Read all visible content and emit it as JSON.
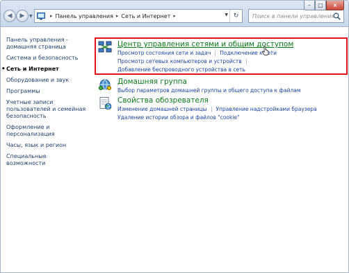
{
  "window": {
    "caption": {
      "minimize": "–",
      "maximize": "□",
      "close": "×"
    }
  },
  "toolbar": {
    "breadcrumb": [
      "Панель управления",
      "Сеть и Интернет"
    ],
    "search_placeholder": "Поиск в панели управления"
  },
  "sidebar": {
    "items": [
      {
        "label": "Панель управления - домашняя страница",
        "active": false
      },
      {
        "label": "Система и безопасность",
        "active": false
      },
      {
        "label": "Сеть и Интернет",
        "active": true
      },
      {
        "label": "Оборудование и звук",
        "active": false
      },
      {
        "label": "Программы",
        "active": false
      },
      {
        "label": "Учетные записи пользователей и семейная безопасность",
        "active": false
      },
      {
        "label": "Оформление и персонализация",
        "active": false
      },
      {
        "label": "Часы, язык и регион",
        "active": false
      },
      {
        "label": "Специальные возможности",
        "active": false
      }
    ]
  },
  "categories": [
    {
      "title": "Центр управления сетями и общим доступом",
      "icon": "network-center-icon",
      "links": [
        [
          "Просмотр состояния сети и задач",
          "Подключение к сети"
        ],
        [
          "Просмотр сетевых компьютеров и устройств"
        ],
        [
          "Добавление беспроводного устройства в сеть"
        ]
      ]
    },
    {
      "title": "Домашняя группа",
      "icon": "homegroup-icon",
      "links": [
        [
          "Выбор параметров домашней группы и общего доступа к файлам"
        ]
      ]
    },
    {
      "title": "Свойства обозревателя",
      "icon": "internet-options-icon",
      "links": [
        [
          "Изменение домашней страницы",
          "Управление надстройками браузера"
        ],
        [
          "Удаление истории обзора и файлов \"cookie\""
        ]
      ]
    }
  ],
  "colors": {
    "category_title": "#0b7a1a",
    "link": "#1b44a0",
    "highlight_border": "#e3101b"
  }
}
